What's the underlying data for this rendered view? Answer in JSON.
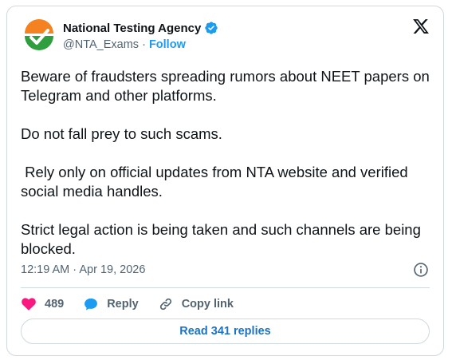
{
  "author": {
    "display_name": "National Testing Agency",
    "handle": "@NTA_Exams",
    "separator": "·",
    "follow_label": "Follow",
    "verified": true,
    "avatar_icon": "nta-logo"
  },
  "tweet": {
    "paragraphs": [
      "Beware of fraudsters spreading rumors about NEET papers on Telegram and other platforms.",
      "Do not fall prey to such scams.",
      " Rely only on official updates from NTA website and verified social media handles.",
      "Strict legal action is being taken and such channels are being blocked."
    ],
    "timestamp": "12:19 AM · Apr 19, 2026"
  },
  "actions": {
    "like_count": "489",
    "reply_label": "Reply",
    "copy_label": "Copy link"
  },
  "replies_button": "Read 341 replies",
  "colors": {
    "like": "#f91880",
    "reply": "#1d9bf0",
    "link": "#1d9bf0",
    "verified": "#1d9bf0",
    "border": "#cfd9de"
  }
}
